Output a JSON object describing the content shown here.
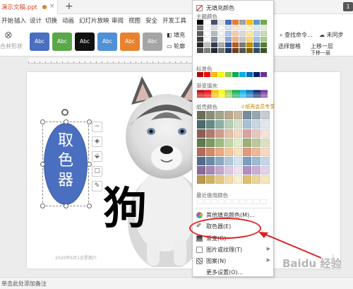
{
  "titlebar": {
    "tab_title": "演示文稿.ppt",
    "tab_close": "×",
    "add_tab": "+",
    "badge": "1"
  },
  "menubar": {
    "items": [
      "开始",
      "插入",
      "设计",
      "切换",
      "动画",
      "幻灯片放映",
      "审阅",
      "视图",
      "安全",
      "开发工具"
    ]
  },
  "ribbon": {
    "styles": [
      {
        "label": "Abc",
        "color": "#4a6fc0"
      },
      {
        "label": "Abc",
        "color": "#5aa84a"
      },
      {
        "label": "Abc",
        "color": "#111111"
      },
      {
        "label": "Abc",
        "color": "#4f91d6"
      },
      {
        "label": "Abc",
        "color": "#e8822f"
      },
      {
        "label": "Abc",
        "color": "#a5a5a5"
      }
    ],
    "merge_label": "合并形状",
    "fill_label": "填充",
    "outline_label": "轮廓",
    "right_items": [
      "查找命令...",
      "未同步",
      "上移一层",
      "下移一层",
      "选择窗格"
    ]
  },
  "dropdown": {
    "no_fill": "无填充颜色",
    "theme_colors_header": "主题颜色",
    "standard_colors_header": "标准色",
    "gradient_fill_header": "渐变填充",
    "stationery_header": "纸壳颜色",
    "vip_label": "纸壳会员专享",
    "recent_header": "最近使用颜色",
    "more_fill": "其他填充颜色(M)...",
    "eyedropper": "取色器(E)",
    "gradient": "渐变(G)",
    "picture_texture": "图片或纹理(T)",
    "pattern": "图案(N)",
    "more_settings": "更多设置(O)..."
  },
  "slide": {
    "oval_text": "取色器",
    "dog_text": "狗",
    "footer_date": "2020年6月1日星期六",
    "page_number": "1"
  },
  "status": {
    "notes_hint": "单击此处添加备注"
  },
  "watermark": "Baidu 经验",
  "colors": {
    "theme_row1": [
      "#000000",
      "#ffffff",
      "#44546a",
      "#e7e6e6",
      "#4472c4",
      "#ed7d31",
      "#a5a5a5",
      "#ffc000",
      "#5b9bd5",
      "#70ad47"
    ],
    "standard": [
      "#c00000",
      "#ff0000",
      "#ffc000",
      "#ffff00",
      "#92d050",
      "#00b050",
      "#00b0f0",
      "#0070c0",
      "#002060",
      "#7030a0"
    ]
  }
}
